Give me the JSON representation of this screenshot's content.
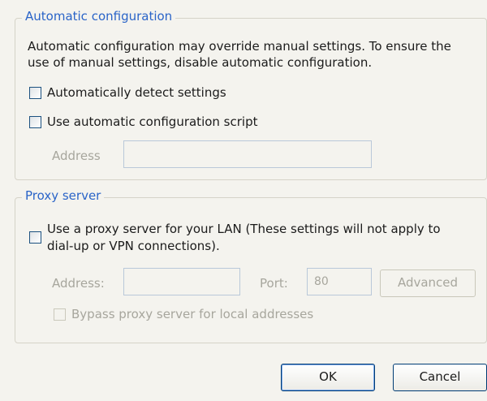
{
  "auto_config": {
    "legend": "Automatic configuration",
    "description_line1": "Automatic configuration may override manual settings.  To ensure the",
    "description_line2": "use of manual settings, disable automatic configuration.",
    "detect_label": "Automatically detect settings",
    "script_label": "Use automatic configuration script",
    "address_label": "Address",
    "address_value": ""
  },
  "proxy": {
    "legend": "Proxy server",
    "use_proxy_line1": "Use a proxy server for your LAN (These settings will not apply to",
    "use_proxy_line2": "dial-up or VPN connections).",
    "address_label": "Address:",
    "address_value": "",
    "port_label": "Port:",
    "port_value": "80",
    "advanced_label": "Advanced",
    "bypass_label": "Bypass proxy server for local addresses"
  },
  "buttons": {
    "ok": "OK",
    "cancel": "Cancel"
  }
}
